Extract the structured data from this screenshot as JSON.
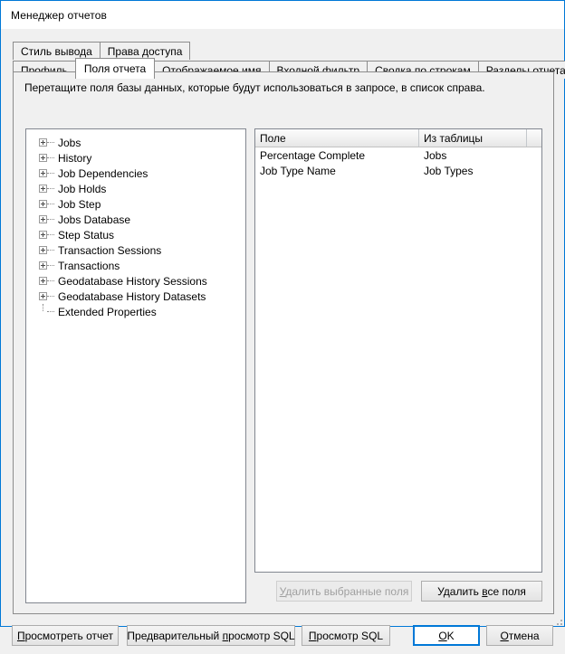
{
  "window": {
    "title": "Менеджер отчетов",
    "accent_color": "#0078d7",
    "background_color": "#f0f0f0"
  },
  "tabs": {
    "row1": [
      {
        "label": "Стиль вывода",
        "selected": false
      },
      {
        "label": "Права доступа",
        "selected": false
      }
    ],
    "row2": [
      {
        "label": "Профиль",
        "selected": false
      },
      {
        "label": "Поля отчета",
        "selected": true
      },
      {
        "label": "Отображаемое имя",
        "selected": false
      },
      {
        "label": "Входной фильтр",
        "selected": false
      },
      {
        "label": "Сводка по строкам",
        "selected": false
      },
      {
        "label": "Разделы отчета",
        "selected": false
      }
    ]
  },
  "panel": {
    "hint": "Перетащите поля базы данных, которые будут использоваться в запросе, в список справа."
  },
  "tree": {
    "nodes": [
      {
        "label": "Jobs",
        "expandable": true
      },
      {
        "label": "History",
        "expandable": true
      },
      {
        "label": "Job Dependencies",
        "expandable": true
      },
      {
        "label": "Job Holds",
        "expandable": true
      },
      {
        "label": "Job Step",
        "expandable": true
      },
      {
        "label": "Jobs Database",
        "expandable": true
      },
      {
        "label": "Step Status",
        "expandable": true
      },
      {
        "label": "Transaction Sessions",
        "expandable": true
      },
      {
        "label": "Transactions",
        "expandable": true
      },
      {
        "label": "Geodatabase History Sessions",
        "expandable": true
      },
      {
        "label": "Geodatabase History Datasets",
        "expandable": true
      },
      {
        "label": "Extended Properties",
        "expandable": false
      }
    ]
  },
  "grid": {
    "columns": [
      {
        "header": "Поле"
      },
      {
        "header": "Из таблицы"
      },
      {
        "header": ""
      }
    ],
    "rows": [
      {
        "field": "Percentage Complete",
        "table": "Jobs",
        "extra": ""
      },
      {
        "field": "Job Type Name",
        "table": "Job Types",
        "extra": ""
      }
    ]
  },
  "buttons": {
    "remove_selected": {
      "label": "Удалить выбранные поля",
      "enabled": false
    },
    "remove_all": {
      "label": "Удалить все поля",
      "enabled": true
    },
    "preview_report": {
      "label": "Просмотреть отчет",
      "enabled": true
    },
    "preview_sql": {
      "label": "Предварительный просмотр SQL",
      "enabled": true
    },
    "view_sql": {
      "label": "Просмотр SQL",
      "enabled": true
    },
    "ok": {
      "label": "OK",
      "enabled": true,
      "default": true
    },
    "cancel": {
      "label": "Отмена",
      "enabled": true
    }
  }
}
